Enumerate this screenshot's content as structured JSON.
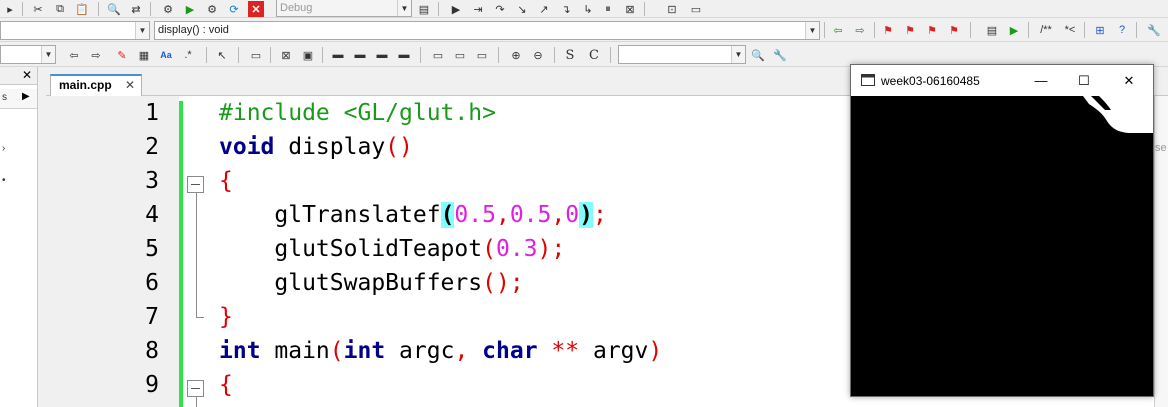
{
  "toolbar": {
    "build_config": "Debug",
    "scope": "display() : void",
    "search_value": ""
  },
  "editor": {
    "file_tab": "main.cpp",
    "line_numbers": [
      "1",
      "2",
      "3",
      "4",
      "5",
      "6",
      "7",
      "8",
      "9"
    ],
    "lines": [
      "#include <GL/glut.h>",
      "void display()",
      "{",
      "    glTranslatef(0.5,0.5,0);",
      "    glutSolidTeapot(0.3);",
      "    glutSwapBuffers();",
      "}",
      "int main(int argc, char ** argv)",
      "{"
    ]
  },
  "glut_window": {
    "title": "week03-06160485",
    "minimize": "—",
    "maximize": "☐",
    "close": "✕"
  },
  "colors": {
    "change_bar": "#2ee34a",
    "keyword": "#00008b",
    "preprocessor": "#1a9a1a",
    "number": "#e020e0",
    "bracket_highlight": "#80ffff"
  }
}
